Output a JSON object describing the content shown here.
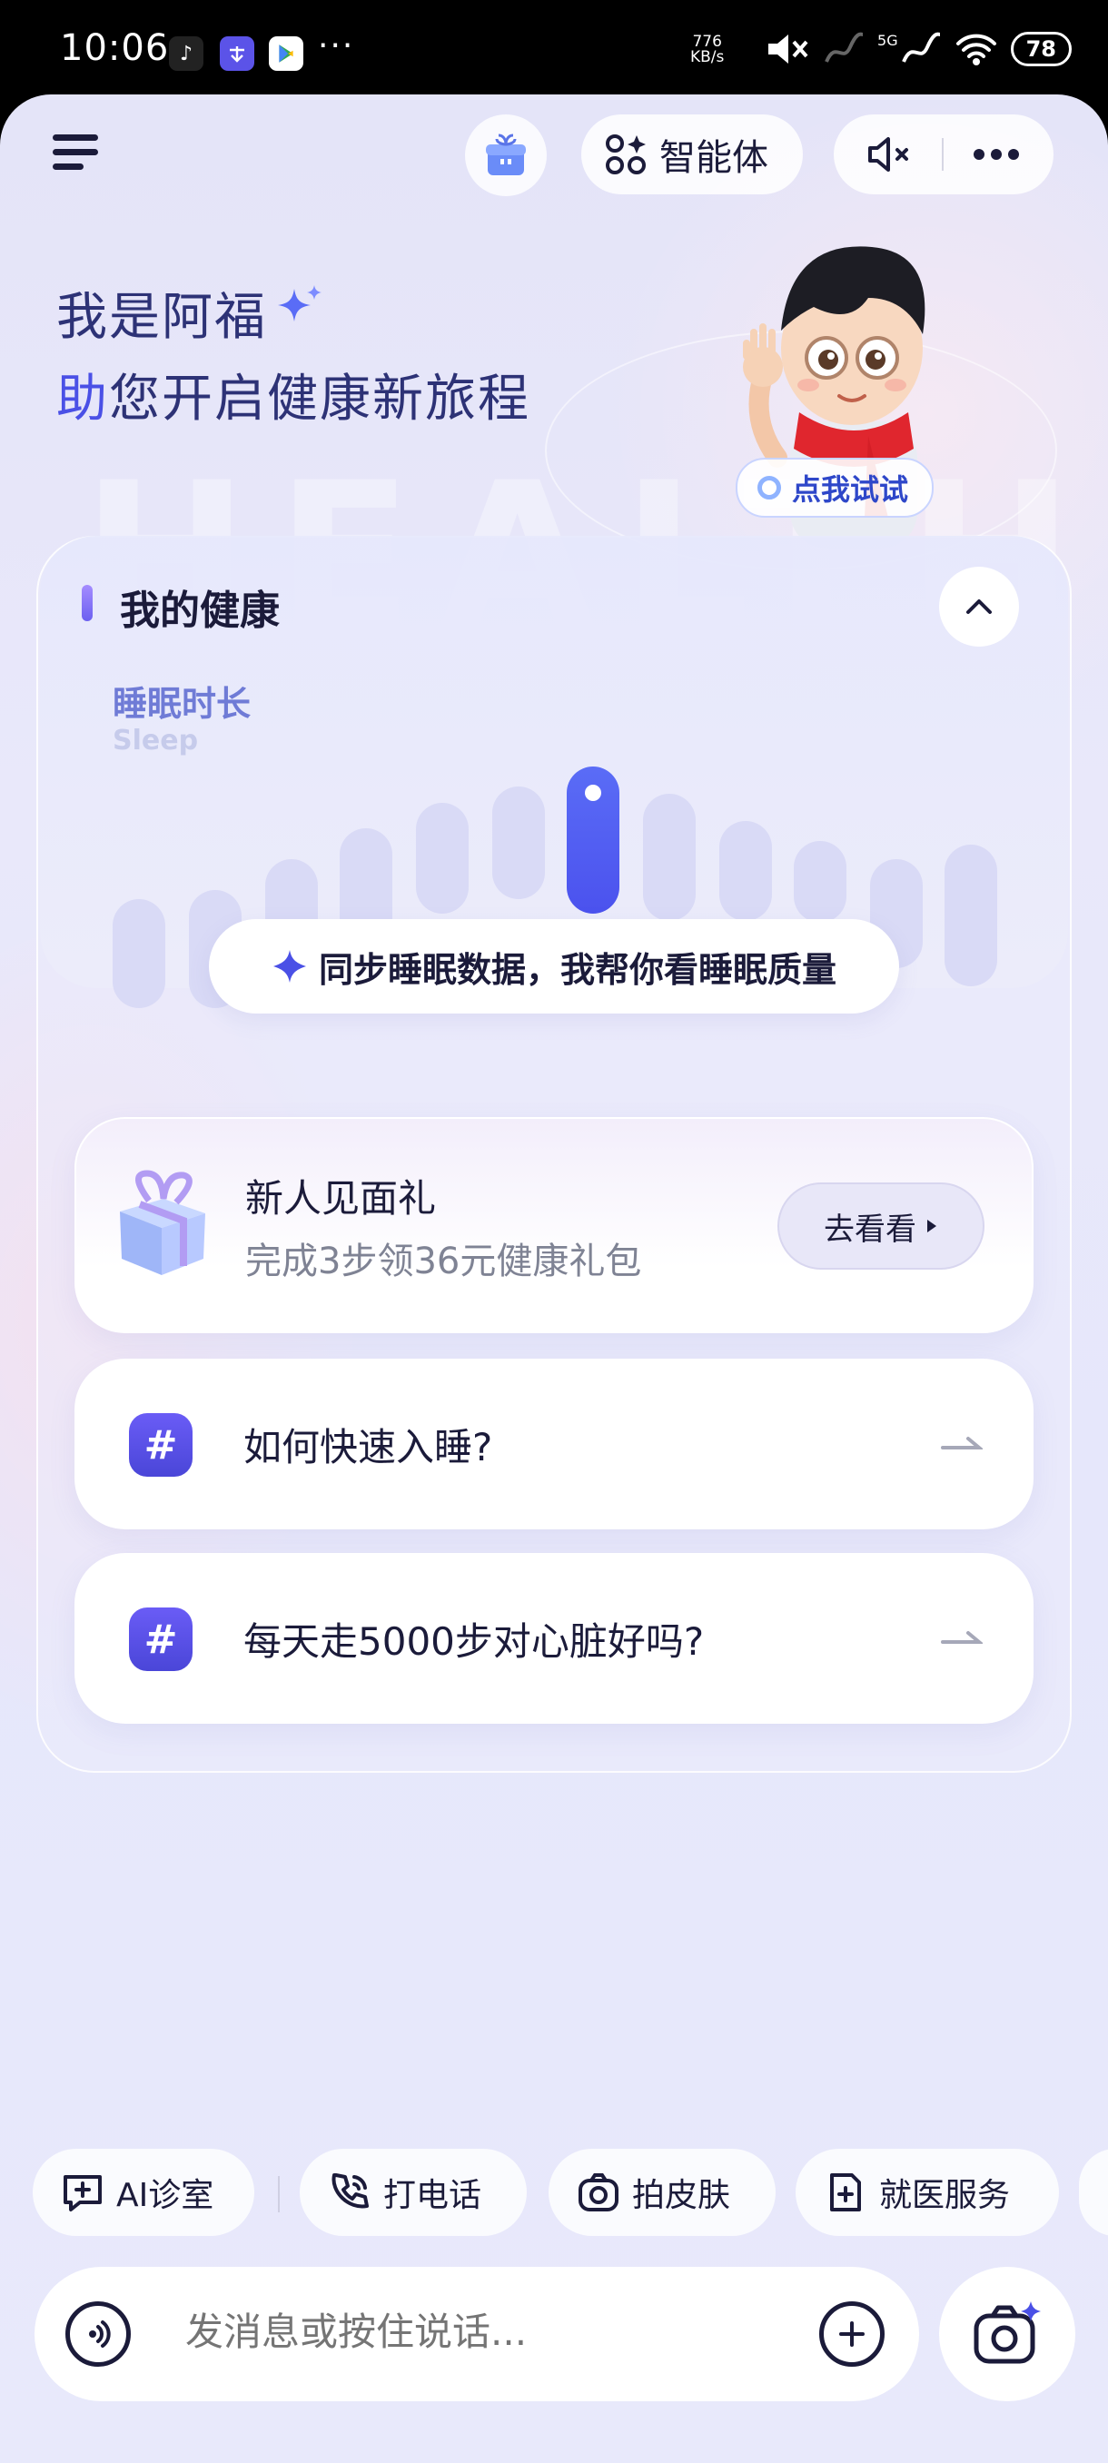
{
  "status_bar": {
    "time": "10:06",
    "net_speed_value": "776",
    "net_speed_unit": "KB/s",
    "signal": "5G",
    "battery": "78",
    "more": "···"
  },
  "header": {
    "agent_label": "智能体"
  },
  "greeting": {
    "line1": "我是阿福",
    "line2_accent": "助",
    "line2_rest": "您开启健康新旅程",
    "try_label": "点我试试"
  },
  "health": {
    "title": "我的健康",
    "metric_zh": "睡眠时长",
    "metric_en": "Sleep",
    "sync_prompt": "同步睡眠数据，我帮你看睡眠质量"
  },
  "gift_card": {
    "title": "新人见面礼",
    "subtitle": "完成3步领36元健康礼包",
    "button": "去看看"
  },
  "questions": [
    {
      "text": "如何快速入睡?"
    },
    {
      "text": "每天走5000步对心脏好吗?"
    }
  ],
  "chips": [
    {
      "label": "AI诊室",
      "icon": "chat-plus-icon"
    },
    {
      "label": "打电话",
      "icon": "phone-icon"
    },
    {
      "label": "拍皮肤",
      "icon": "camera-icon"
    },
    {
      "label": "就医服务",
      "icon": "medical-doc-icon"
    }
  ],
  "input": {
    "placeholder": "发消息或按住说话..."
  },
  "colors": {
    "accent": "#4a50e6",
    "text_dark": "#1b1b3a",
    "greeting_text": "#2d3276"
  }
}
